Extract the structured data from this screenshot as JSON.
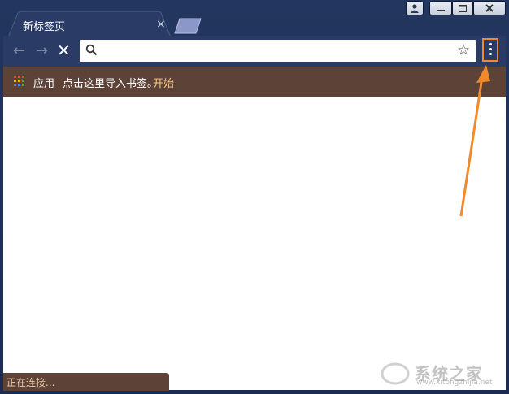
{
  "tab": {
    "title": "新标签页",
    "close": "×"
  },
  "toolbar": {
    "back": "←",
    "forward": "→",
    "stop": "✕",
    "star": "☆"
  },
  "omnibox": {
    "value": ""
  },
  "bookmarks": {
    "apps_label": "应用",
    "import_text": "点击这里导入书签。",
    "start_link": "开始"
  },
  "status": {
    "text": "正在连接..."
  },
  "watermark": {
    "name": "系统之家",
    "url": "www.xitongzhijia.net"
  },
  "colors": {
    "frame": "#23365f",
    "toolbar": "#2a3c66",
    "bookmarks_bar": "#5d4337",
    "accent_orange": "#f08a2a"
  },
  "icons": [
    "user-icon",
    "minimize-icon",
    "maximize-icon",
    "close-icon",
    "back-icon",
    "forward-icon",
    "stop-icon",
    "search-icon",
    "star-icon",
    "menu-icon",
    "apps-icon"
  ]
}
